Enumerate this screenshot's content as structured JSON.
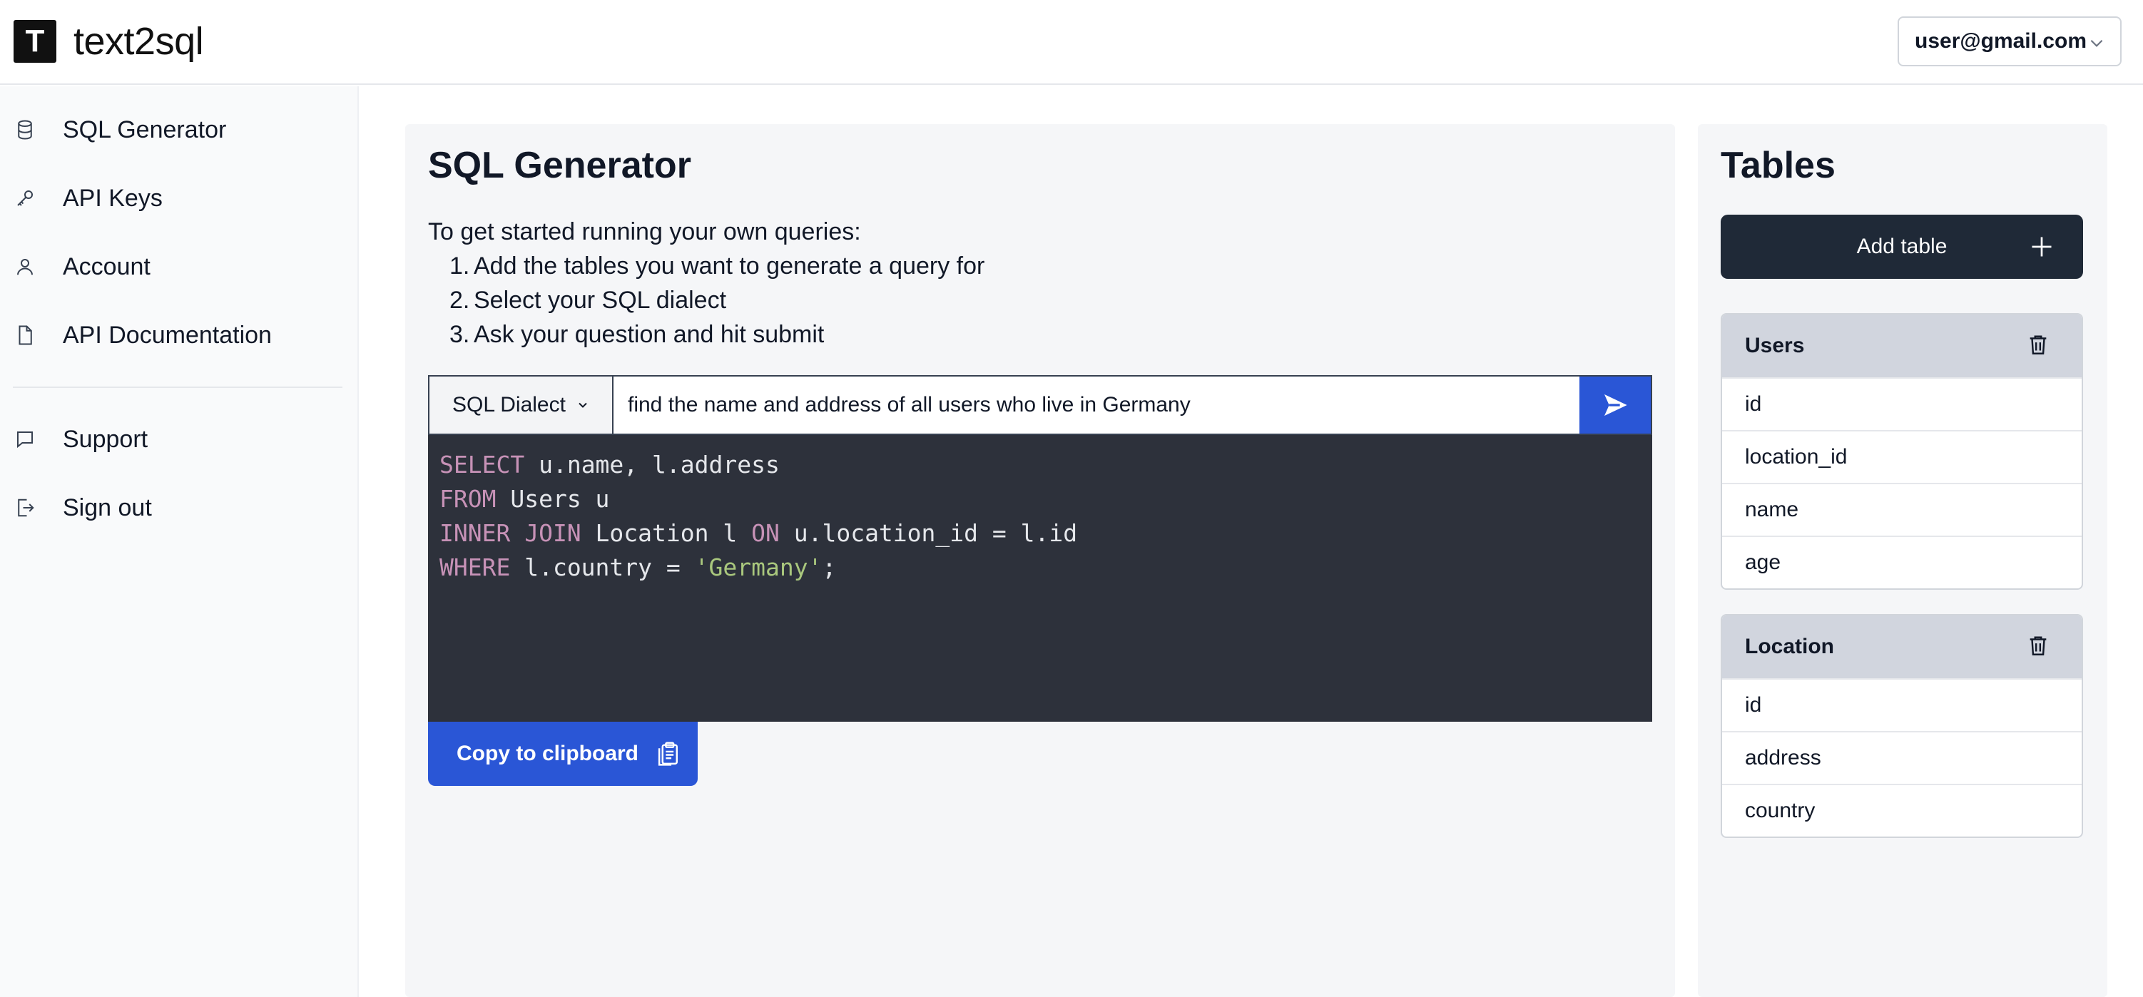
{
  "header": {
    "logo_letter": "T",
    "app_title": "text2sql",
    "user_email": "user@gmail.com"
  },
  "sidebar": {
    "items": [
      {
        "label": "SQL Generator",
        "icon": "database-icon"
      },
      {
        "label": "API Keys",
        "icon": "key-icon"
      },
      {
        "label": "Account",
        "icon": "user-icon"
      },
      {
        "label": "API Documentation",
        "icon": "document-icon"
      }
    ],
    "footer_items": [
      {
        "label": "Support",
        "icon": "chat-icon"
      },
      {
        "label": "Sign out",
        "icon": "sign-out-icon"
      }
    ]
  },
  "main": {
    "title": "SQL Generator",
    "intro": "To get started running your own queries:",
    "steps": [
      "Add the tables you want to generate a query for",
      "Select your SQL dialect",
      "Ask your question and hit submit"
    ],
    "dialect_label": "SQL Dialect",
    "query_value": "find the name and address of all users who live in Germany",
    "sql_lines": [
      [
        {
          "t": "SELECT",
          "k": "kw"
        },
        {
          "t": " u.name, l.address",
          "k": ""
        }
      ],
      [
        {
          "t": "FROM",
          "k": "kw"
        },
        {
          "t": " Users u",
          "k": ""
        }
      ],
      [
        {
          "t": "INNER JOIN",
          "k": "kw"
        },
        {
          "t": " Location l ",
          "k": ""
        },
        {
          "t": "ON",
          "k": "kw"
        },
        {
          "t": " u.location_id = l.id",
          "k": ""
        }
      ],
      [
        {
          "t": "WHERE",
          "k": "kw"
        },
        {
          "t": " l.country = ",
          "k": ""
        },
        {
          "t": "'Germany'",
          "k": "str"
        },
        {
          "t": ";",
          "k": ""
        }
      ]
    ],
    "copy_label": "Copy to clipboard"
  },
  "tables_panel": {
    "title": "Tables",
    "add_label": "Add table",
    "tables": [
      {
        "name": "Users",
        "columns": [
          "id",
          "location_id",
          "name",
          "age"
        ]
      },
      {
        "name": "Location",
        "columns": [
          "id",
          "address",
          "country"
        ]
      }
    ]
  },
  "colors": {
    "accent": "#2a56d6",
    "dark_button": "#1f2937",
    "code_bg": "#2d313b",
    "keyword": "#c792b7",
    "string": "#a9c77d"
  }
}
